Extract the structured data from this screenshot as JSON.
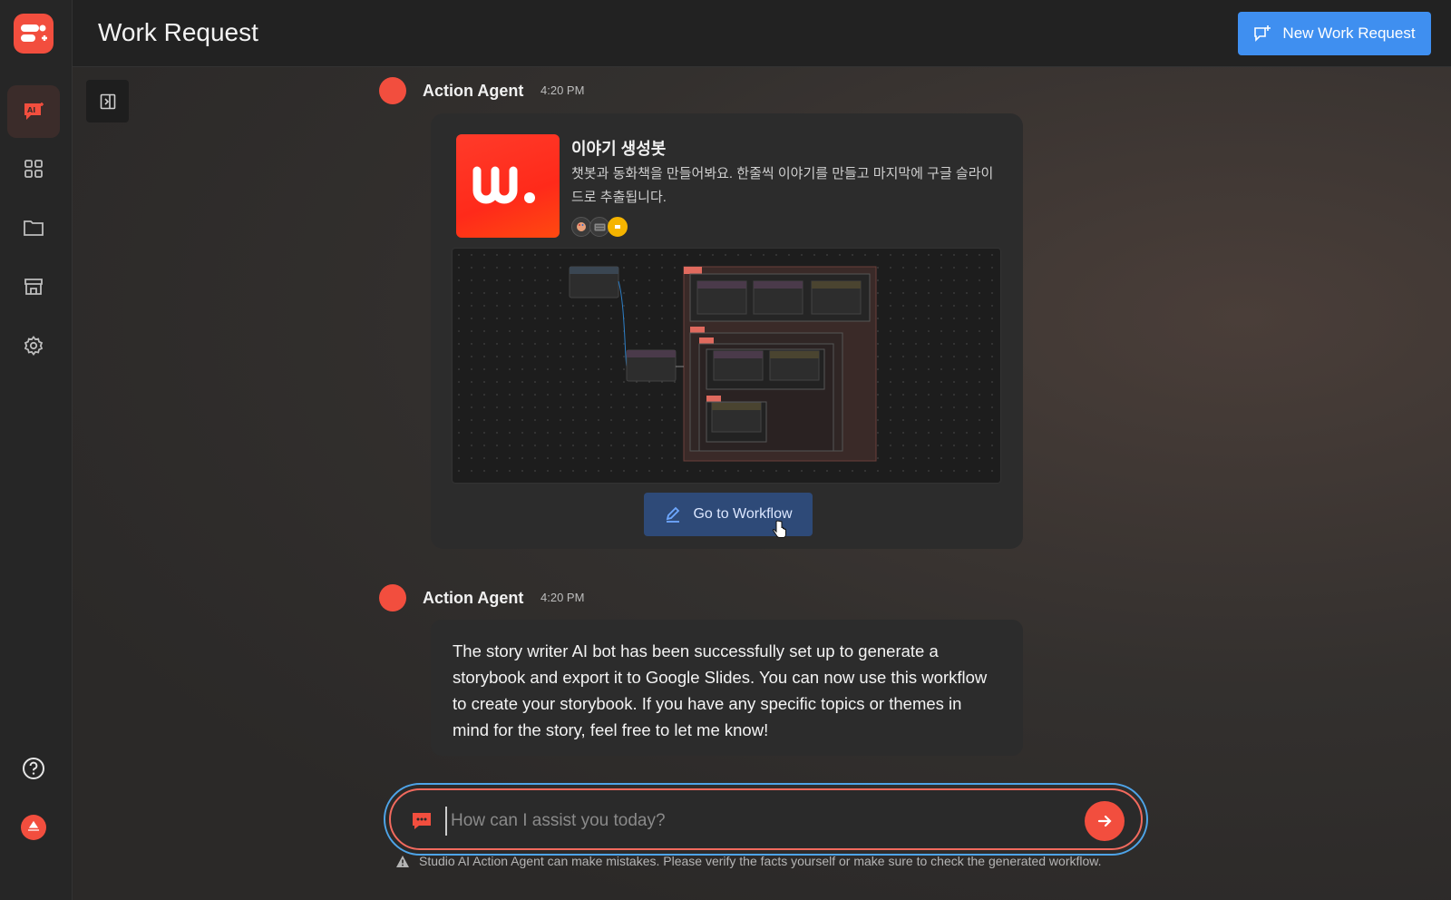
{
  "header": {
    "title": "Work Request",
    "new_button_label": "New Work Request"
  },
  "sidebar": {
    "items": [
      {
        "name": "ai-chat",
        "icon": "ai-chat-icon",
        "active": true
      },
      {
        "name": "apps",
        "icon": "grid-icon",
        "active": false
      },
      {
        "name": "files",
        "icon": "folder-icon",
        "active": false
      },
      {
        "name": "store",
        "icon": "store-icon",
        "active": false
      },
      {
        "name": "settings",
        "icon": "gear-icon",
        "active": false
      }
    ],
    "bottom": [
      {
        "name": "help",
        "icon": "help-icon"
      },
      {
        "name": "user",
        "icon": "user-avatar-icon"
      }
    ]
  },
  "messages": [
    {
      "author": "Action Agent",
      "time": "4:20 PM",
      "card": {
        "title": "이야기 생성봇",
        "description": "챗봇과 동화책을 만들어봐요. 한줄씩 이야기를 만들고 마지막에 구글 슬라이드로 추출됩니다.",
        "button_label": "Go to Workflow"
      }
    },
    {
      "author": "Action Agent",
      "time": "4:20 PM",
      "text": "The story writer AI bot has been successfully set up to generate a storybook and export it to Google Slides. You can now use this workflow to create your storybook. If you have any specific topics or themes in mind for the story, feel free to let me know!"
    }
  ],
  "composer": {
    "placeholder": "How can I assist you today?"
  },
  "disclaimer": "Studio AI Action Agent can make mistakes. Please verify the facts yourself or make sure to check the generated workflow.",
  "colors": {
    "accent": "#f24e3e",
    "primary_button": "#3f8ff0",
    "workflow_button": "#2e4a78"
  }
}
